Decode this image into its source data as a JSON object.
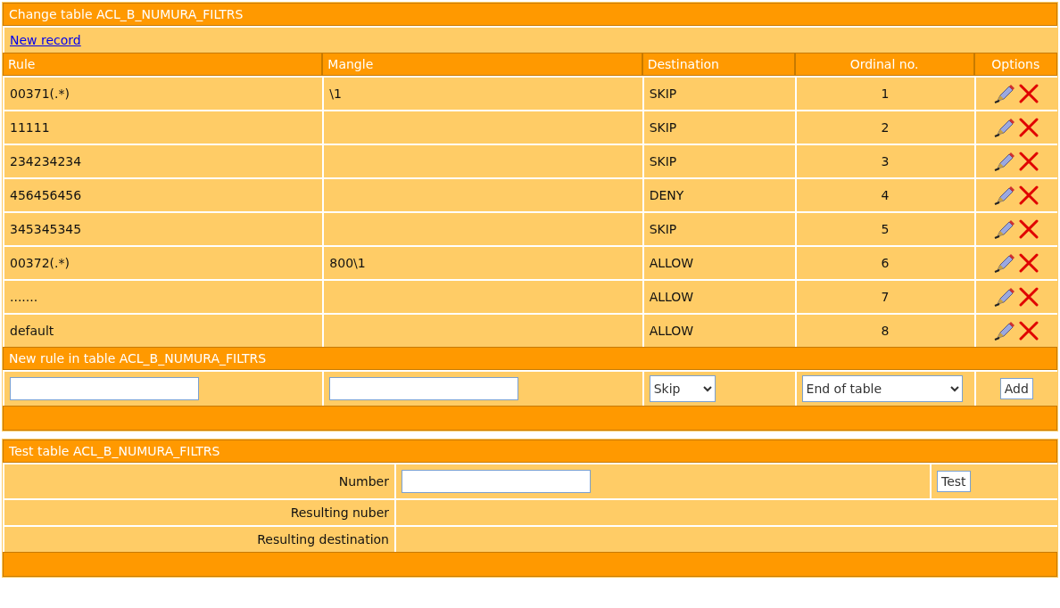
{
  "change_table": {
    "title": "Change table ACL_B_NUMURA_FILTRS",
    "new_record_link": "New record",
    "columns": [
      "Rule",
      "Mangle",
      "Destination",
      "Ordinal no.",
      "Options"
    ],
    "rows": [
      {
        "rule": "00371(.*)",
        "mangle": "\\1",
        "destination": "SKIP",
        "ordinal": "1"
      },
      {
        "rule": "11111",
        "mangle": "",
        "destination": "SKIP",
        "ordinal": "2"
      },
      {
        "rule": "234234234",
        "mangle": "",
        "destination": "SKIP",
        "ordinal": "3"
      },
      {
        "rule": "456456456",
        "mangle": "",
        "destination": "DENY",
        "ordinal": "4"
      },
      {
        "rule": "345345345",
        "mangle": "",
        "destination": "SKIP",
        "ordinal": "5"
      },
      {
        "rule": "00372(.*)",
        "mangle": "800\\1",
        "destination": "ALLOW",
        "ordinal": "6"
      },
      {
        "rule": ".......",
        "mangle": "",
        "destination": "ALLOW",
        "ordinal": "7"
      },
      {
        "rule": "default",
        "mangle": "",
        "destination": "ALLOW",
        "ordinal": "8"
      }
    ],
    "new_rule": {
      "title": "New rule in table ACL_B_NUMURA_FILTRS",
      "destination_select": "Skip",
      "position_select": "End of table",
      "add_button": "Add"
    }
  },
  "test_table": {
    "title": "Test table ACL_B_NUMURA_FILTRS",
    "number_label": "Number",
    "test_button": "Test",
    "result_number_label": "Resulting nuber",
    "result_destination_label": "Resulting destination"
  }
}
